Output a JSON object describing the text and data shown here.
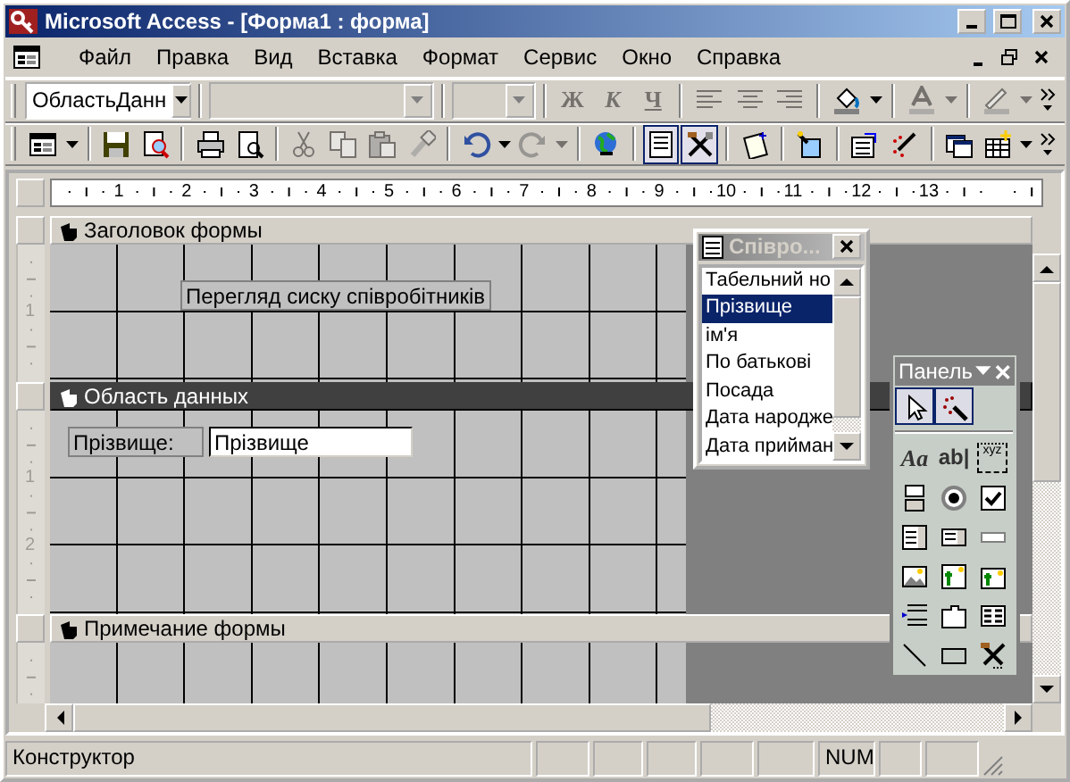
{
  "window": {
    "title": "Microsoft Access - [Форма1 : форма]"
  },
  "menu": [
    "Файл",
    "Правка",
    "Вид",
    "Вставка",
    "Формат",
    "Сервис",
    "Окно",
    "Справка"
  ],
  "format_toolbar": {
    "object": "ОбластьДанн",
    "style_buttons": [
      {
        "label": "Ж",
        "disabled": true
      },
      {
        "label": "К",
        "disabled": true
      },
      {
        "label": "Ч",
        "disabled": true
      }
    ],
    "tool_buttons": [
      {
        "disabled": true
      },
      {
        "disabled": true
      },
      {
        "disabled": true
      },
      {
        "disabled": false
      },
      {
        "disabled": true
      },
      {
        "disabled": true
      }
    ]
  },
  "design_toolbar": [
    {
      "pressed": false,
      "disabled": false
    },
    {
      "pressed": false,
      "disabled": false
    },
    {
      "pressed": false,
      "disabled": false
    },
    {
      "pressed": false,
      "disabled": false
    },
    {
      "pressed": false,
      "disabled": false
    },
    {
      "pressed": false,
      "disabled": true
    },
    {
      "pressed": false,
      "disabled": true
    },
    {
      "pressed": false,
      "disabled": true
    },
    {
      "pressed": false,
      "disabled": true
    },
    {
      "pressed": false,
      "disabled": false
    },
    {
      "pressed": false,
      "disabled": true
    },
    {
      "pressed": false,
      "disabled": false
    },
    {
      "pressed": true,
      "disabled": false
    },
    {
      "pressed": true,
      "disabled": false
    },
    {
      "pressed": false,
      "disabled": false
    },
    {
      "pressed": false,
      "disabled": false
    },
    {
      "pressed": false,
      "disabled": false
    },
    {
      "pressed": false,
      "disabled": false
    },
    {
      "pressed": false,
      "disabled": false
    },
    {
      "pressed": false,
      "disabled": false
    }
  ],
  "ruler": [
    "1",
    "2",
    "3",
    "4",
    "5",
    "6",
    "7",
    "8",
    "9",
    "10",
    "11",
    "12",
    "13"
  ],
  "sections": [
    {
      "title": "Заголовок формы",
      "selected": false,
      "ruler": [
        "1"
      ],
      "controls": [
        {
          "kind": "label",
          "text": "Перегляд сиску співробітників"
        }
      ]
    },
    {
      "title": "Область данных",
      "selected": true,
      "ruler": [
        "1",
        "2"
      ],
      "controls": [
        {
          "kind": "label",
          "text": "Прізвище:"
        },
        {
          "kind": "textbox",
          "text": "Прізвище"
        }
      ]
    },
    {
      "title": "Примечание формы",
      "selected": false
    }
  ],
  "field_list": {
    "title": "Співро...",
    "items": [
      {
        "text": "Табельний но",
        "selected": false
      },
      {
        "text": "Прізвище",
        "selected": true
      },
      {
        "text": "ім'я",
        "selected": false
      },
      {
        "text": "По батькові",
        "selected": false
      },
      {
        "text": "Посада",
        "selected": false
      },
      {
        "text": "Дата народже",
        "selected": false
      },
      {
        "text": "Дата прийман",
        "selected": false
      }
    ]
  },
  "toolbox": {
    "title": "Панель",
    "tools": [
      {
        "pressed": true
      },
      {
        "pressed": true
      },
      {
        "glyph": "Aa",
        "pressed": false
      },
      {
        "glyph": "ab|",
        "pressed": false
      },
      {
        "glyph": "xyz",
        "pressed": false
      },
      {
        "pressed": false
      },
      {
        "pressed": false
      },
      {
        "pressed": false
      },
      {
        "pressed": false
      },
      {
        "pressed": false
      },
      {
        "pressed": false
      },
      {
        "pressed": false
      },
      {
        "pressed": false
      },
      {
        "pressed": false
      },
      {
        "pressed": false
      },
      {
        "pressed": false
      },
      {
        "pressed": false
      },
      {
        "pressed": false
      },
      {
        "pressed": false
      },
      {
        "pressed": false
      }
    ]
  },
  "status_bar": {
    "mode": "Конструктор",
    "indicator": "NUM"
  }
}
